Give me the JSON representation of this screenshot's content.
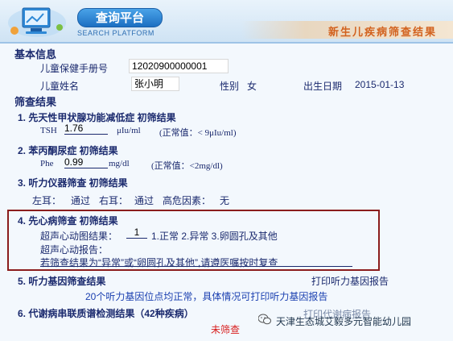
{
  "header": {
    "title": "查询平台",
    "subtitle": "SEARCH PLATFORM",
    "right_title": "新生儿疾病筛查结果"
  },
  "basic": {
    "section_title": "基本信息",
    "handbook_label": "儿童保健手册号",
    "handbook_value": "12020900000001",
    "name_label": "儿童姓名",
    "name_value": "张小明",
    "gender_label": "性别",
    "gender_value": "女",
    "birth_label": "出生日期",
    "birth_value": "2015-01-13"
  },
  "results": {
    "section_title": "筛查结果",
    "item1": {
      "title": "1. 先天性甲状腺功能减低症 初筛结果",
      "code": "TSH",
      "value": "1.76",
      "unit": "μIu/ml",
      "normal": "(正常值：< 9μIu/ml)"
    },
    "item2": {
      "title": "2. 苯丙酮尿症 初筛结果",
      "code": "Phe",
      "value": "0.99",
      "unit": "mg/dl",
      "normal": "(正常值：<2mg/dl)"
    },
    "item3": {
      "title": "3. 听力仪器筛查 初筛结果",
      "left_label": "左耳：",
      "left_value": "通过",
      "right_label": "右耳：",
      "right_value": "通过",
      "risk_label": "高危因素：",
      "risk_value": "无"
    },
    "item4": {
      "title": "4. 先心病筛查 初筛结果",
      "echo_label": "超声心动图结果：",
      "echo_value": "1",
      "echo_options": "1.正常 2.异常 3.卵圆孔及其他",
      "report_label": "超声心动报告：",
      "note": "若筛查结果为“异常”或“卵圆孔及其他”,请遵医嘱按时复查"
    },
    "item5": {
      "title": "5. 听力基因筛查结果",
      "print_link": "打印听力基因报告",
      "desc": "20个听力基因位点均正常，具体情况可打印听力基因报告"
    },
    "item6": {
      "title": "6. 代谢病串联质谱检测结果（42种疾病）",
      "print_link": "打印代谢病报告",
      "status": "未筛查"
    }
  },
  "watermark": {
    "text": "天津生态城艾毅多元智能幼儿园"
  },
  "colors": {
    "header_title_bg": "#1c6fc2",
    "accent_orange": "#d2611d",
    "text_navy": "#1b2a6e",
    "highlight_box": "#8b1d1d",
    "status_red": "#d81e1e"
  }
}
